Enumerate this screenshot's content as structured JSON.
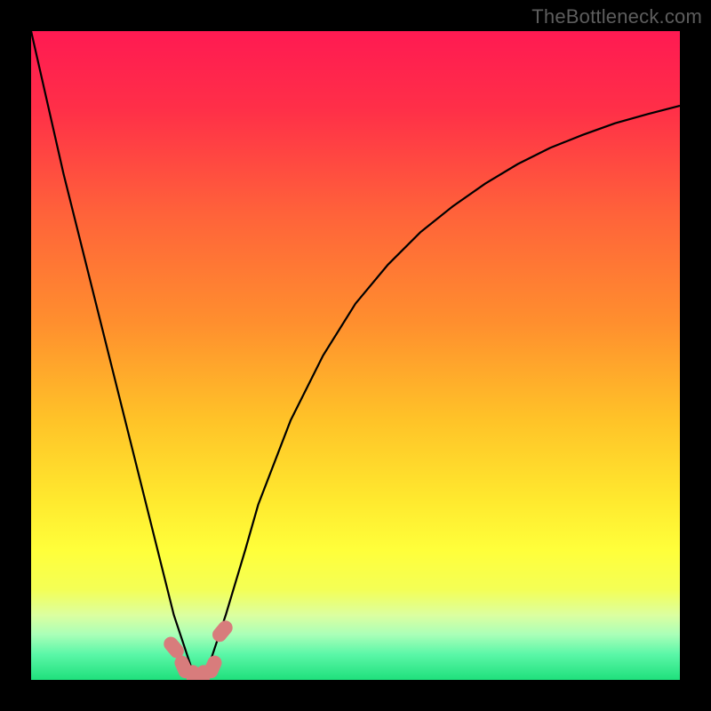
{
  "watermark": "TheBottleneck.com",
  "chart_data": {
    "type": "line",
    "title": "",
    "xlabel": "",
    "ylabel": "",
    "xlim": [
      0,
      100
    ],
    "ylim": [
      0,
      100
    ],
    "grid": false,
    "legend": false,
    "series": [
      {
        "name": "bottleneck-curve",
        "x": [
          0,
          5,
          10,
          15,
          17,
          20,
          22,
          24,
          25,
          26,
          27,
          28,
          30,
          33,
          35,
          40,
          45,
          50,
          55,
          60,
          65,
          70,
          75,
          80,
          85,
          90,
          95,
          100
        ],
        "y": [
          100,
          78,
          58,
          38,
          30,
          18,
          10,
          4,
          1,
          0,
          1,
          4,
          10,
          20,
          27,
          40,
          50,
          58,
          64,
          69,
          73,
          76.5,
          79.5,
          82,
          84,
          85.8,
          87.2,
          88.5
        ]
      }
    ],
    "markers": {
      "name": "highlight-markers",
      "x": [
        22.0,
        23.5,
        25.0,
        26.5,
        28.0,
        29.5
      ],
      "y": [
        5.0,
        2.0,
        0.5,
        0.5,
        2.0,
        7.5
      ]
    },
    "gradient_stops": [
      {
        "offset": 0.0,
        "color": "#ff1a52"
      },
      {
        "offset": 0.12,
        "color": "#ff2f48"
      },
      {
        "offset": 0.28,
        "color": "#ff623a"
      },
      {
        "offset": 0.45,
        "color": "#ff8f2e"
      },
      {
        "offset": 0.6,
        "color": "#ffc328"
      },
      {
        "offset": 0.72,
        "color": "#ffe82e"
      },
      {
        "offset": 0.8,
        "color": "#ffff3a"
      },
      {
        "offset": 0.86,
        "color": "#f4ff55"
      },
      {
        "offset": 0.9,
        "color": "#dcffa0"
      },
      {
        "offset": 0.93,
        "color": "#aaffb8"
      },
      {
        "offset": 0.96,
        "color": "#5cf7a8"
      },
      {
        "offset": 1.0,
        "color": "#1fe07c"
      }
    ],
    "marker_color": "#d87c7c",
    "curve_color": "#000000"
  }
}
